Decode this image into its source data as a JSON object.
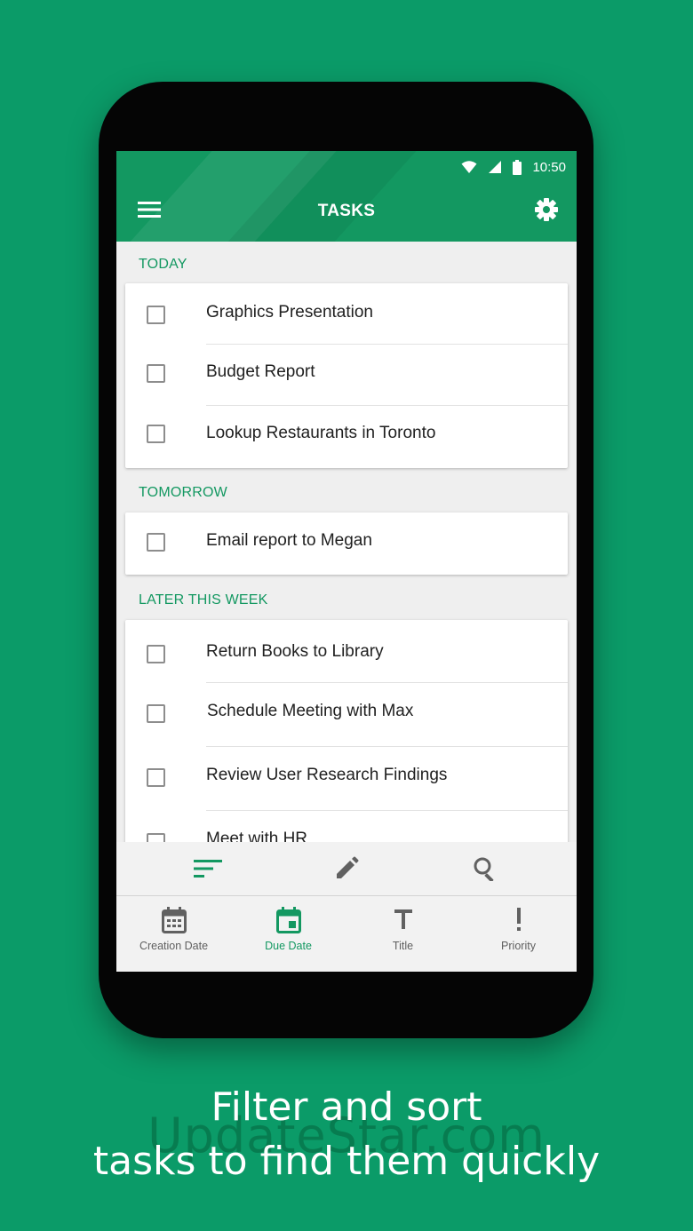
{
  "status_bar": {
    "time": "10:50"
  },
  "app_bar": {
    "title": "TASKS"
  },
  "sections": [
    {
      "header": "TODAY",
      "tasks": [
        "Graphics Presentation",
        "Budget Report",
        "Lookup Restaurants in Toronto"
      ]
    },
    {
      "header": "TOMORROW",
      "tasks": [
        "Email report to Megan"
      ]
    },
    {
      "header": "LATER THIS WEEK",
      "tasks": [
        "Return Books to Library",
        "Schedule Meeting with Max",
        "Review User Research Findings",
        "Meet with HR"
      ]
    }
  ],
  "action_bar": {
    "icons": [
      "sort-icon",
      "edit-icon",
      "search-icon"
    ]
  },
  "bottom_nav": {
    "items": [
      {
        "label": "Creation Date",
        "icon": "calendar-icon"
      },
      {
        "label": "Due Date",
        "icon": "calendar-event-icon"
      },
      {
        "label": "Title",
        "icon": "text-title-icon"
      },
      {
        "label": "Priority",
        "icon": "exclamation-icon"
      }
    ],
    "active": "Due Date"
  },
  "caption": {
    "line1": "Filter and sort",
    "line2": "tasks to find them quickly"
  },
  "watermark": "UpdateStar.com",
  "colors": {
    "background": "#0b9b68",
    "accent": "#139861"
  }
}
